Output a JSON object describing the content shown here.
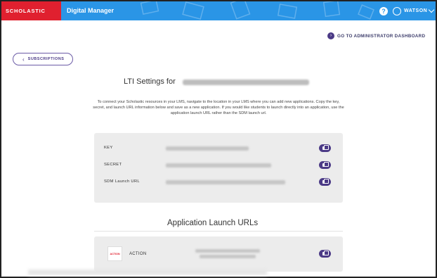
{
  "header": {
    "brand": "SCHOLASTIC",
    "app_title": "Digital Manager",
    "help_icon": "help-icon",
    "user_name": "WATSON"
  },
  "admin_link": {
    "label": "GO TO ADMINISTRATOR DASHBOARD"
  },
  "back_button": {
    "label": "SUBSCRIPTIONS"
  },
  "page": {
    "title": "LTI Settings for",
    "intro": "To connect your Scholastic resources in your LMS, navigate to the location in your LMS where you can add new applications. Copy the key, secret, and launch URL information below and save as a new application. If you would like students to launch directly into an application, use the application launch URL rather than the SDM launch url."
  },
  "credentials": [
    {
      "label": "KEY"
    },
    {
      "label": "SECRET"
    },
    {
      "label": "SDM Launch URL"
    }
  ],
  "apps_section": {
    "title": "Application Launch URLs",
    "apps": [
      {
        "logo_text": "ACTION",
        "name": "ACTION"
      }
    ]
  },
  "colors": {
    "header_blue": "#2a95e6",
    "brand_red": "#e0202f",
    "accent_purple": "#4b3a86",
    "panel_gray": "#ececec"
  }
}
